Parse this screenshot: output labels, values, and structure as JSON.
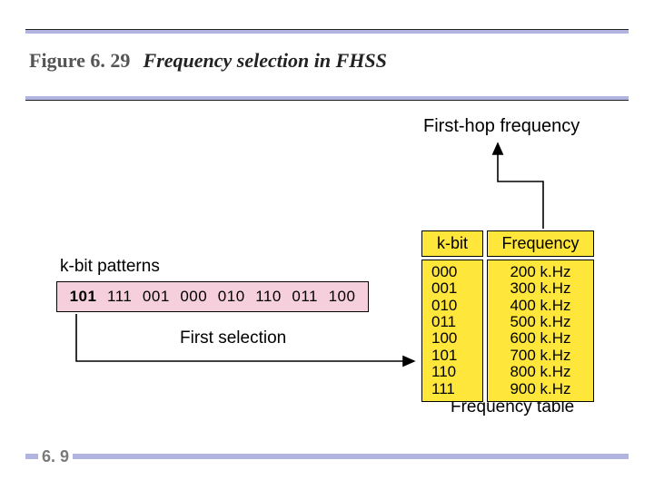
{
  "figure": {
    "number": "Figure 6. 29",
    "caption": "Frequency selection in FHSS"
  },
  "page": "6. 9",
  "labels": {
    "first_hop": "First-hop frequency",
    "kbit_patterns": "k-bit patterns",
    "first_selection": "First selection",
    "freq_table": "Frequency table"
  },
  "patterns": [
    "101",
    "111",
    "001",
    "000",
    "010",
    "110",
    "011",
    "100"
  ],
  "table": {
    "kbit_header": "k-bit",
    "freq_header": "Frequency",
    "rows": [
      {
        "k": "000",
        "f": "200 k.Hz"
      },
      {
        "k": "001",
        "f": "300 k.Hz"
      },
      {
        "k": "010",
        "f": "400 k.Hz"
      },
      {
        "k": "011",
        "f": "500 k.Hz"
      },
      {
        "k": "100",
        "f": "600 k.Hz"
      },
      {
        "k": "101",
        "f": "700 k.Hz"
      },
      {
        "k": "110",
        "f": "800 k.Hz"
      },
      {
        "k": "111",
        "f": "900 k.Hz"
      }
    ]
  }
}
